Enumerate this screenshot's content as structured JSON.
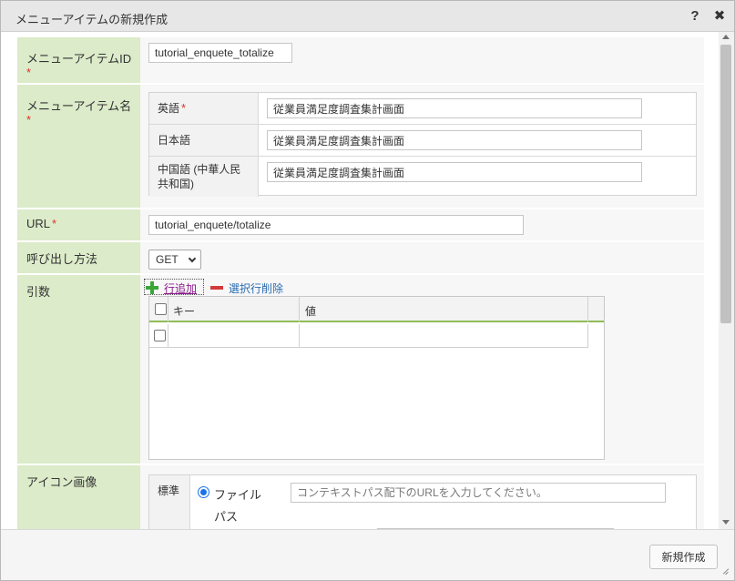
{
  "dialog": {
    "title": "メニューアイテムの新規作成",
    "help_label": "?",
    "close_label": "✖"
  },
  "form": {
    "required_mark": "*",
    "menu_item_id": {
      "label": "メニューアイテムID",
      "value": "tutorial_enquete_totalize"
    },
    "menu_item_name": {
      "label": "メニューアイテム名",
      "languages": [
        {
          "label": "英語",
          "required": true,
          "value": "従業員満足度調査集計画面"
        },
        {
          "label": "日本語",
          "required": false,
          "value": "従業員満足度調査集計画面"
        },
        {
          "label": "中国語 (中華人民共和国)",
          "required": false,
          "value": "従業員満足度調査集計画面"
        }
      ]
    },
    "url": {
      "label": "URL",
      "value": "tutorial_enquete/totalize"
    },
    "call_method": {
      "label": "呼び出し方法",
      "selected": "GET"
    },
    "arguments": {
      "label": "引数",
      "add_row_label": "行追加",
      "delete_rows_label": "選択行削除",
      "columns": [
        "キー",
        "値"
      ]
    },
    "icon_image": {
      "label": "アイコン画像",
      "standard_label": "標準",
      "file_path_label": "ファイルパス",
      "placeholder": "コンテキストパス配下のURLを入力してください。"
    }
  },
  "footer": {
    "create_label": "新規作成"
  }
}
